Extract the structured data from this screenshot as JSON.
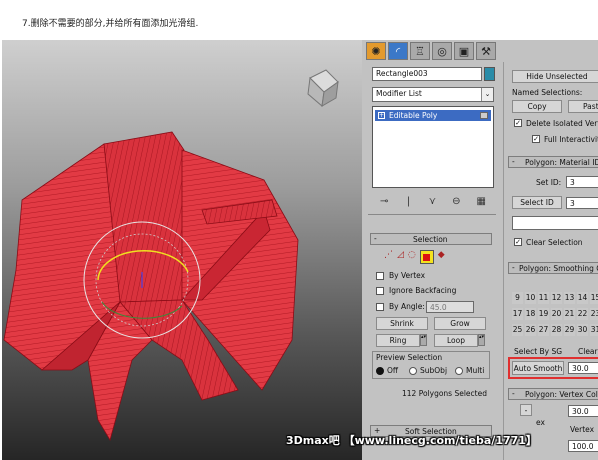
{
  "caption": "7.删除不需要的部分,并给所有面添加光滑组.",
  "panel": {
    "tabs": [
      "✺",
      "◜",
      "♖",
      "◎",
      "▣",
      "⚒"
    ],
    "object_name": "Rectangle003",
    "modifier_list": "Modifier List",
    "stack_item": "Editable Poly",
    "selection": {
      "title": "Selection",
      "by_vertex": "By Vertex",
      "ignore_backfacing": "Ignore Backfacing",
      "by_angle": "By Angle:",
      "angle_value": "45.0",
      "shrink": "Shrink",
      "grow": "Grow",
      "ring": "Ring",
      "loop": "Loop",
      "preview_title": "Preview Selection",
      "off": "Off",
      "subobj": "SubObj",
      "multi": "Multi",
      "status": "112 Polygons Selected"
    },
    "soft_selection": "Soft Selection",
    "right": {
      "hide_unselected": "Hide Unselected",
      "named_selections": "Named Selections:",
      "copy": "Copy",
      "paste": "Past",
      "delete_isolated": "Delete Isolated Vert",
      "full_interactivity": "Full Interactivit",
      "material_title": "Polygon: Material ID",
      "set_id": "Set ID:",
      "set_id_value": "3",
      "select_id": "Select ID",
      "select_id_value": "3",
      "clear_selection": "Clear Selection",
      "smoothing_title": "Polygon: Smoothing Gr",
      "sg_rows": [
        [
          "9",
          "10",
          "11",
          "12",
          "13",
          "14",
          "15"
        ],
        [
          "17",
          "18",
          "19",
          "20",
          "21",
          "22",
          "23"
        ],
        [
          "25",
          "26",
          "27",
          "28",
          "29",
          "30",
          "31"
        ]
      ],
      "select_by_sg": "Select By SG",
      "clear": "Clear",
      "auto_smooth": "Auto Smooth",
      "auto_smooth_value": "30.0",
      "vertex_colors_title": "Polygon: Vertex Colo",
      "vc_value1": "30.0",
      "vc_label": "Vertex",
      "vc_value2": "100.0",
      "vc_misc": "ex"
    }
  },
  "watermark": "3Dmax吧 【www.linecg.com/tieba/1771】",
  "colors": {
    "mesh": "#e23a44",
    "mesh_dark": "#a5101c",
    "highlight_box": "#e03030"
  }
}
